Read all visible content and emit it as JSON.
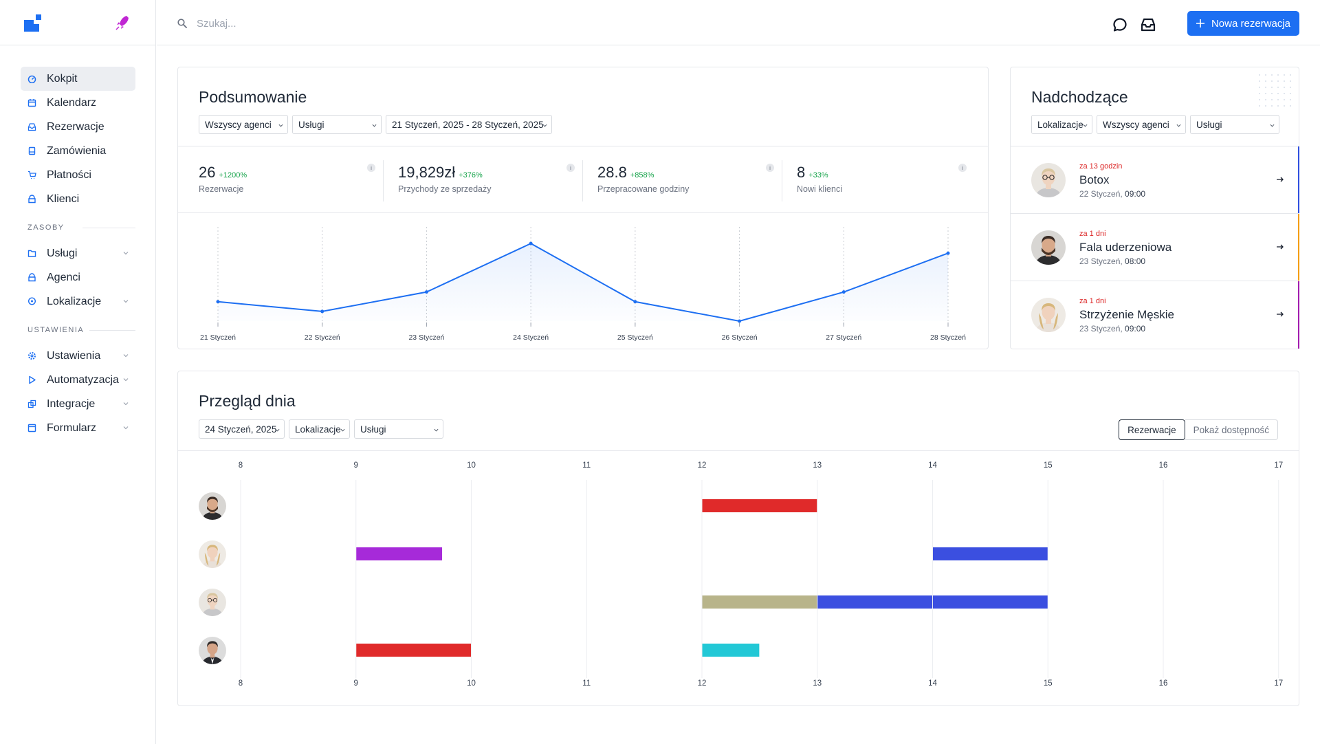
{
  "search": {
    "placeholder": "Szukaj..."
  },
  "topbar": {
    "new_button_label": "Nowa rezerwacja"
  },
  "sidebar": {
    "main_items": [
      {
        "label": "Kokpit",
        "icon": "dashboard-icon",
        "active": true
      },
      {
        "label": "Kalendarz",
        "icon": "calendar-icon"
      },
      {
        "label": "Rezerwacje",
        "icon": "inbox-icon"
      },
      {
        "label": "Zamówienia",
        "icon": "orders-icon"
      },
      {
        "label": "Płatności",
        "icon": "payments-icon"
      },
      {
        "label": "Klienci",
        "icon": "clients-icon"
      }
    ],
    "section_resources": "ZASOBY",
    "resources_items": [
      {
        "label": "Usługi",
        "icon": "folder-icon",
        "expandable": true
      },
      {
        "label": "Agenci",
        "icon": "agent-icon"
      },
      {
        "label": "Lokalizacje",
        "icon": "location-icon",
        "expandable": true
      }
    ],
    "section_settings": "USTAWIENIA",
    "settings_items": [
      {
        "label": "Ustawienia",
        "icon": "gear-icon",
        "expandable": true
      },
      {
        "label": "Automatyzacja",
        "icon": "play-icon",
        "expandable": true
      },
      {
        "label": "Integracje",
        "icon": "integrations-icon",
        "expandable": true
      },
      {
        "label": "Formularz",
        "icon": "form-icon",
        "expandable": true
      }
    ]
  },
  "summary": {
    "title": "Podsumowanie",
    "filters": {
      "agents": "Wszyscy agenci",
      "services": "Usługi",
      "date_range": "21 Styczeń, 2025 - 28 Styczeń, 2025"
    },
    "stats": [
      {
        "value": "26",
        "delta": "+1200%",
        "label": "Rezerwacje"
      },
      {
        "value": "19,829zł",
        "delta": "+376%",
        "label": "Przychody ze sprzedaży"
      },
      {
        "value": "28.8",
        "delta": "+858%",
        "label": "Przepracowane godziny"
      },
      {
        "value": "8",
        "delta": "+33%",
        "label": "Nowi klienci"
      }
    ],
    "info_glyph": "i"
  },
  "chart_data": {
    "type": "line",
    "categories": [
      "21 Styczeń",
      "22 Styczeń",
      "23 Styczeń",
      "24 Styczeń",
      "25 Styczeń",
      "26 Styczeń",
      "27 Styczeń",
      "28 Styczeń"
    ],
    "values": [
      2,
      1,
      3,
      8,
      2,
      0,
      3,
      7
    ],
    "ylim": [
      0,
      9
    ],
    "grid": "vertical dashed",
    "color": "#1d6ff2"
  },
  "upcoming": {
    "title": "Nadchodzące",
    "filters": {
      "locations": "Lokalizacje",
      "agents": "Wszyscy agenci",
      "services": "Usługi"
    },
    "items": [
      {
        "when": "za 13 godzin",
        "name": "Botox",
        "date": "22 Styczeń,",
        "time": "09:00",
        "color": "#2f4fe0",
        "avatar": "woman-glasses"
      },
      {
        "when": "za 1 dni",
        "name": "Fala uderzeniowa",
        "date": "23 Styczeń,",
        "time": "08:00",
        "color": "#f59e0b",
        "avatar": "man-beard"
      },
      {
        "when": "za 1 dni",
        "name": "Strzyżenie Męskie",
        "date": "23 Styczeń,",
        "time": "09:00",
        "color": "#a21caf",
        "avatar": "woman-blonde"
      }
    ]
  },
  "day_overview": {
    "title": "Przegląd dnia",
    "filters": {
      "date": "24 Styczeń, 2025",
      "locations": "Lokalizacje",
      "services": "Usługi"
    },
    "toggle": {
      "bookings": "Rezerwacje",
      "availability": "Pokaż dostępność"
    },
    "hours": [
      "8",
      "9",
      "10",
      "11",
      "12",
      "13",
      "14",
      "15",
      "16",
      "17"
    ],
    "rows": [
      {
        "avatar": "man-beard",
        "bookings": [
          {
            "start": 12,
            "end": 13,
            "color": "#e02a2a"
          }
        ]
      },
      {
        "avatar": "woman-blonde",
        "bookings": [
          {
            "start": 9,
            "end": 9.75,
            "color": "#a62ad9"
          },
          {
            "start": 14,
            "end": 15,
            "color": "#3b4fe0"
          }
        ]
      },
      {
        "avatar": "woman-glasses",
        "bookings": [
          {
            "start": 12,
            "end": 13,
            "color": "#b8b48a"
          },
          {
            "start": 13,
            "end": 14,
            "color": "#3b4fe0"
          },
          {
            "start": 14,
            "end": 15,
            "color": "#3b4fe0"
          }
        ]
      },
      {
        "avatar": "man-suit",
        "bookings": [
          {
            "start": 9,
            "end": 10,
            "color": "#e02a2a"
          },
          {
            "start": 12,
            "end": 12.5,
            "color": "#22c8d6"
          }
        ]
      }
    ]
  }
}
